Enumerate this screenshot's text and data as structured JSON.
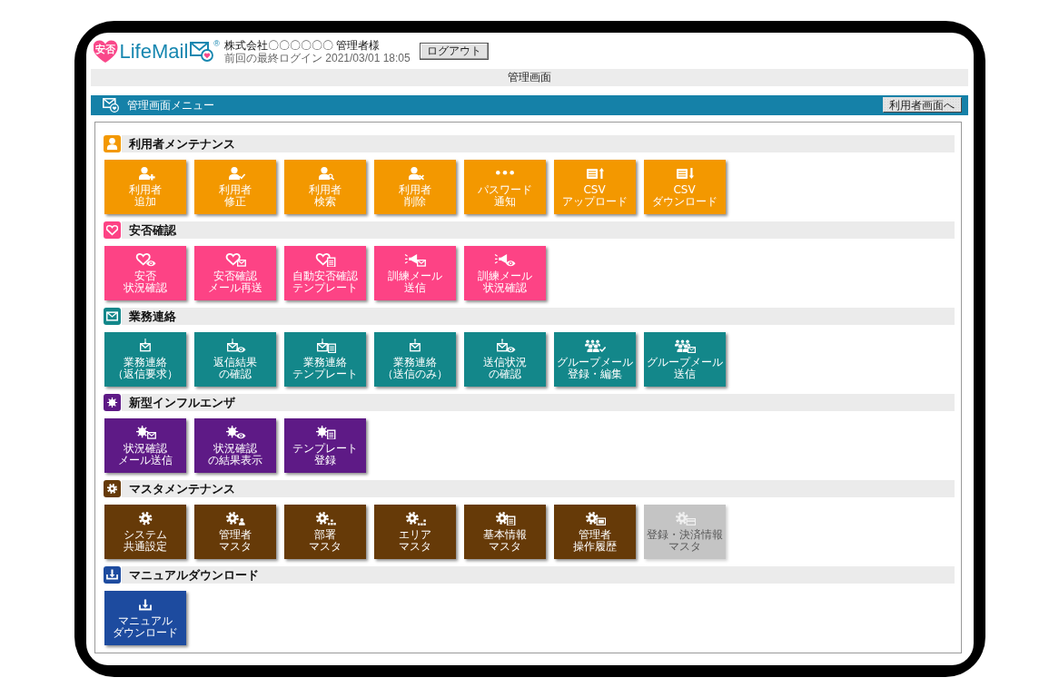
{
  "header": {
    "logo": {
      "badge": "安否",
      "name": "LifeMail",
      "mark": "®"
    },
    "company": "株式会社〇〇〇〇〇〇 管理者様",
    "last_login": "前回の最終ログイン 2021/03/01 18:05",
    "logout_button": "ログアウト"
  },
  "page_title": "管理画面",
  "menu_bar": {
    "title": "管理画面メニュー",
    "button": "利用者画面へ"
  },
  "sections": [
    {
      "title": "利用者メンテナンス",
      "kind": "person",
      "color": "#f39800",
      "tiles": [
        {
          "lines": [
            "利用者",
            "追加"
          ],
          "kind": "useradd",
          "disabled": false
        },
        {
          "lines": [
            "利用者",
            "修正"
          ],
          "kind": "useredit",
          "disabled": false
        },
        {
          "lines": [
            "利用者",
            "検索"
          ],
          "kind": "usersearch",
          "disabled": false
        },
        {
          "lines": [
            "利用者",
            "削除"
          ],
          "kind": "userdelete",
          "disabled": false
        },
        {
          "lines": [
            "パスワード",
            "通知"
          ],
          "kind": "password",
          "disabled": false
        },
        {
          "lines": [
            "CSV",
            "アップロード"
          ],
          "kind": "upload",
          "disabled": false
        },
        {
          "lines": [
            "CSV",
            "ダウンロード"
          ],
          "kind": "download",
          "disabled": false
        }
      ]
    },
    {
      "title": "安否確認",
      "kind": "heart",
      "color": "#fd4385",
      "tiles": [
        {
          "lines": [
            "安否",
            "状況確認"
          ],
          "kind": "heartview",
          "disabled": false
        },
        {
          "lines": [
            "安否確認",
            "メール再送"
          ],
          "kind": "heartmail",
          "disabled": false
        },
        {
          "lines": [
            "自動安否確認",
            "テンプレート"
          ],
          "kind": "hearttemplate",
          "disabled": false
        },
        {
          "lines": [
            "訓練メール",
            "送信"
          ],
          "kind": "drillmail",
          "disabled": false
        },
        {
          "lines": [
            "訓練メール",
            "状況確認"
          ],
          "kind": "drillview",
          "disabled": false
        }
      ]
    },
    {
      "title": "業務連絡",
      "kind": "mail",
      "color": "#13878a",
      "tiles": [
        {
          "lines": [
            "業務連絡",
            "（返信要求）"
          ],
          "kind": "mailin",
          "disabled": false
        },
        {
          "lines": [
            "返信結果",
            "の確認"
          ],
          "kind": "replyview",
          "disabled": false
        },
        {
          "lines": [
            "業務連絡",
            "テンプレート"
          ],
          "kind": "mailtemplate",
          "disabled": false
        },
        {
          "lines": [
            "業務連絡",
            "（送信のみ）"
          ],
          "kind": "mailout",
          "disabled": false
        },
        {
          "lines": [
            "送信状況",
            "の確認"
          ],
          "kind": "sentview",
          "disabled": false
        },
        {
          "lines": [
            "グループメール",
            "登録・編集"
          ],
          "kind": "groupedit",
          "disabled": false
        },
        {
          "lines": [
            "グループメール",
            "送信"
          ],
          "kind": "groupmail",
          "disabled": false
        }
      ]
    },
    {
      "title": "新型インフルエンザ",
      "kind": "virus",
      "color": "#5e1a86",
      "tiles": [
        {
          "lines": [
            "状況確認",
            "メール送信"
          ],
          "kind": "virusmail",
          "disabled": false
        },
        {
          "lines": [
            "状況確認",
            "の結果表示"
          ],
          "kind": "virusview",
          "disabled": false
        },
        {
          "lines": [
            "テンプレート",
            "登録"
          ],
          "kind": "virustemplate",
          "disabled": false
        }
      ]
    },
    {
      "title": "マスタメンテナンス",
      "kind": "gear",
      "color": "#663a08",
      "tiles": [
        {
          "lines": [
            "システム",
            "共通設定"
          ],
          "kind": "gear",
          "disabled": false
        },
        {
          "lines": [
            "管理者",
            "マスタ"
          ],
          "kind": "gearuser",
          "disabled": false
        },
        {
          "lines": [
            "部署",
            "マスタ"
          ],
          "kind": "geardept",
          "disabled": false
        },
        {
          "lines": [
            "エリア",
            "マスタ"
          ],
          "kind": "geararea",
          "disabled": false
        },
        {
          "lines": [
            "基本情報",
            "マスタ"
          ],
          "kind": "geardoc",
          "disabled": false
        },
        {
          "lines": [
            "管理者",
            "操作履歴"
          ],
          "kind": "gearscreen",
          "disabled": false
        },
        {
          "lines": [
            "登録・決済情報",
            "マスタ"
          ],
          "kind": "gearcard",
          "disabled": true
        }
      ]
    },
    {
      "title": "マニュアルダウンロード",
      "kind": "download",
      "color": "#1d4b9f",
      "tiles": [
        {
          "lines": [
            "マニュアル",
            "ダウンロード"
          ],
          "kind": "tray",
          "disabled": false
        }
      ]
    }
  ]
}
